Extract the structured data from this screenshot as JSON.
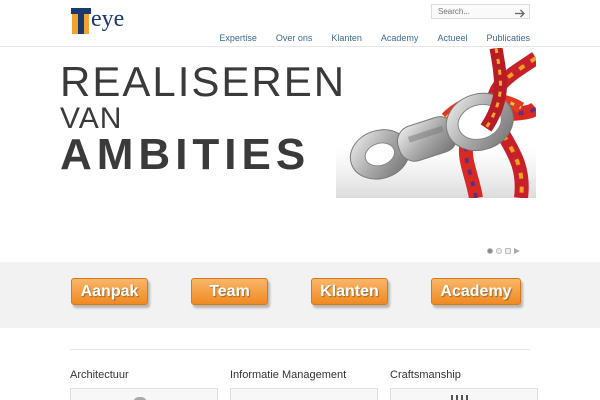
{
  "header": {
    "logo_text": "eye",
    "search": {
      "placeholder": "Search..."
    },
    "nav": [
      {
        "label": "Expertise"
      },
      {
        "label": "Over ons"
      },
      {
        "label": "Klanten"
      },
      {
        "label": "Academy"
      },
      {
        "label": "Actueel"
      },
      {
        "label": "Publicaties"
      }
    ]
  },
  "slider": {
    "line1": "REALISEREN",
    "line2": "VAN",
    "line3": "AMBITIES",
    "image_icon": "rope-carabiner-image",
    "pager": {
      "active_index": 0
    }
  },
  "actions": [
    {
      "label": "Aanpak"
    },
    {
      "label": "Team"
    },
    {
      "label": "Klanten"
    },
    {
      "label": "Academy"
    }
  ],
  "columns": [
    {
      "title": "Architectuur"
    },
    {
      "title": "Informatie Management"
    },
    {
      "title": "Craftsmanship"
    }
  ],
  "colors": {
    "accent_orange": "#f08a22",
    "brand_blue": "#1b3a6b",
    "nav_blue": "#3d6b8f"
  }
}
